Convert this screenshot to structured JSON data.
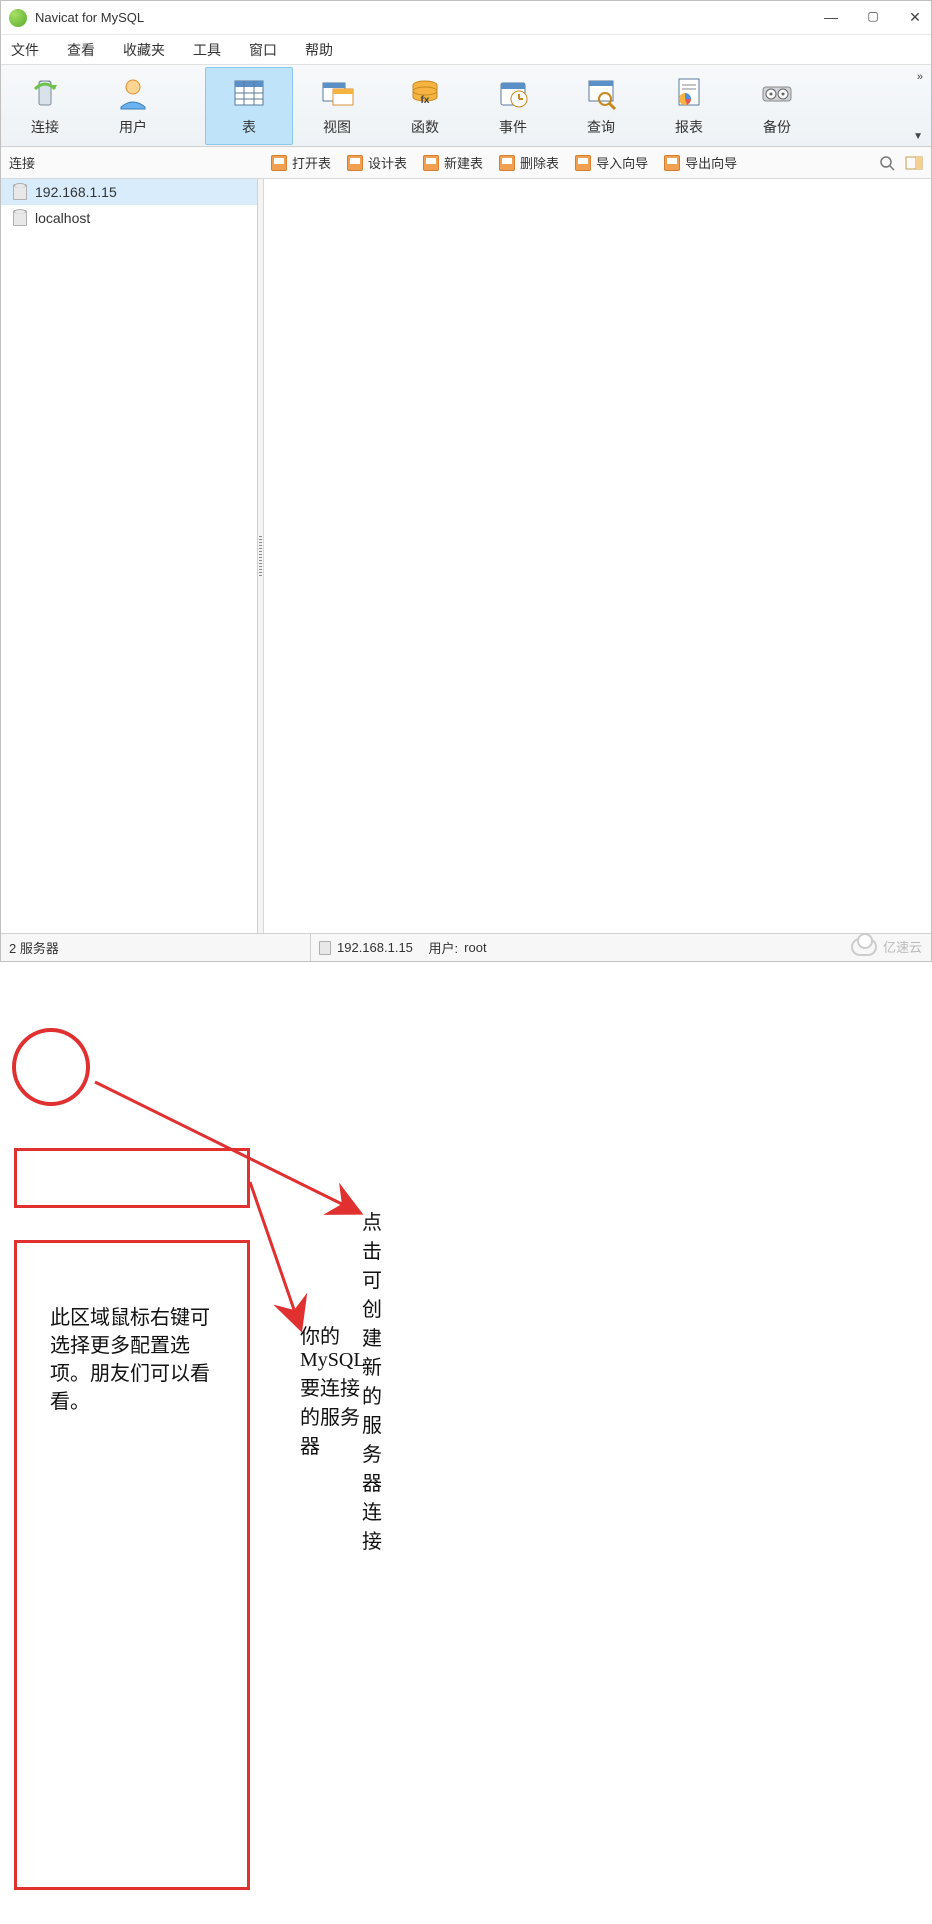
{
  "title": "Navicat for MySQL",
  "menubar": [
    "文件",
    "查看",
    "收藏夹",
    "工具",
    "窗口",
    "帮助"
  ],
  "toolbar": [
    {
      "label": "连接",
      "icon": "server",
      "selected": false
    },
    {
      "label": "用户",
      "icon": "user",
      "selected": false
    },
    {
      "label": "表",
      "icon": "table",
      "selected": true
    },
    {
      "label": "视图",
      "icon": "view",
      "selected": false
    },
    {
      "label": "函数",
      "icon": "function",
      "selected": false
    },
    {
      "label": "事件",
      "icon": "event",
      "selected": false
    },
    {
      "label": "查询",
      "icon": "query",
      "selected": false
    },
    {
      "label": "报表",
      "icon": "report",
      "selected": false
    },
    {
      "label": "备份",
      "icon": "backup",
      "selected": false
    }
  ],
  "subbar": {
    "left_label": "连接",
    "actions": [
      "打开表",
      "设计表",
      "新建表",
      "删除表",
      "导入向导",
      "导出向导"
    ]
  },
  "connections": [
    {
      "name": "192.168.1.15",
      "selected": true
    },
    {
      "name": "localhost",
      "selected": false
    }
  ],
  "statusbar": {
    "left": "2 服务器",
    "host": "192.168.1.15",
    "user_label": "用户:",
    "user": "root"
  },
  "annotations": {
    "a1": "点击可创建新的服务器连接",
    "a2": "你的MySQL要连接的服务器",
    "a3": "此区域鼠标右键可选择更多配置选项。朋友们可以看看。"
  },
  "watermark": "亿速云"
}
